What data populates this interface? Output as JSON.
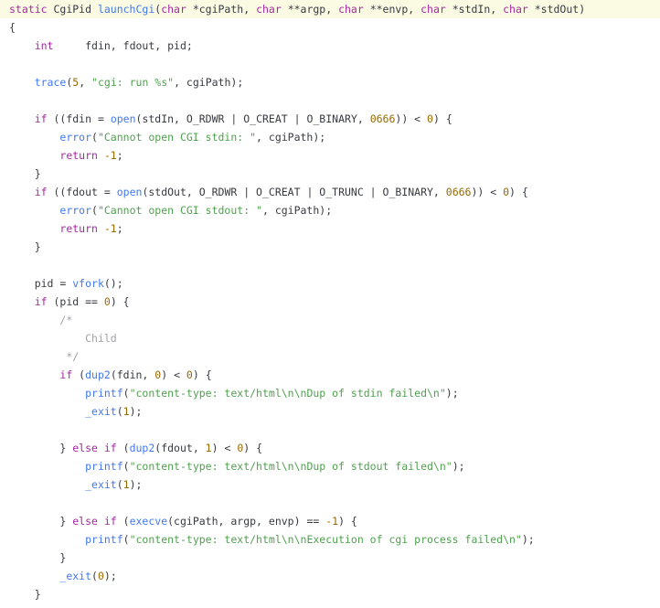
{
  "colors": {
    "kw": "#a626a4",
    "cm": "#a0a1a7",
    "fn": "#4078f2",
    "num": "#986801",
    "str": "#50a14f",
    "plain": "#383a42",
    "highlight": "#fbfbe3"
  },
  "code": {
    "lines": [
      {
        "tokens": [
          {
            "t": "kw",
            "v": "static "
          },
          {
            "t": "plain",
            "v": "CgiPid "
          },
          {
            "t": "fn",
            "v": "launchCgi"
          },
          {
            "t": "plain",
            "v": "("
          },
          {
            "t": "kw",
            "v": "char"
          },
          {
            "t": "plain",
            "v": " *cgiPath, "
          },
          {
            "t": "kw",
            "v": "char"
          },
          {
            "t": "plain",
            "v": " **argp, "
          },
          {
            "t": "kw",
            "v": "char"
          },
          {
            "t": "plain",
            "v": " **envp, "
          },
          {
            "t": "kw",
            "v": "char"
          },
          {
            "t": "plain",
            "v": " *stdIn, "
          },
          {
            "t": "kw",
            "v": "char"
          },
          {
            "t": "plain",
            "v": " *stdOut)"
          }
        ],
        "highlight": true
      },
      {
        "tokens": [
          {
            "t": "plain",
            "v": "{"
          }
        ]
      },
      {
        "tokens": [
          {
            "t": "plain",
            "v": "    "
          },
          {
            "t": "kw",
            "v": "int"
          },
          {
            "t": "plain",
            "v": "     fdin, fdout, pid;"
          }
        ]
      },
      {
        "tokens": [
          {
            "t": "plain",
            "v": ""
          }
        ]
      },
      {
        "tokens": [
          {
            "t": "plain",
            "v": "    "
          },
          {
            "t": "fn",
            "v": "trace"
          },
          {
            "t": "plain",
            "v": "("
          },
          {
            "t": "num",
            "v": "5"
          },
          {
            "t": "plain",
            "v": ", "
          },
          {
            "t": "str",
            "v": "\"cgi: run %s\""
          },
          {
            "t": "plain",
            "v": ", cgiPath);"
          }
        ]
      },
      {
        "tokens": [
          {
            "t": "plain",
            "v": ""
          }
        ]
      },
      {
        "tokens": [
          {
            "t": "plain",
            "v": "    "
          },
          {
            "t": "kw",
            "v": "if"
          },
          {
            "t": "plain",
            "v": " ((fdin = "
          },
          {
            "t": "fn",
            "v": "open"
          },
          {
            "t": "plain",
            "v": "(stdIn, O_RDWR | O_CREAT | O_BINARY, "
          },
          {
            "t": "num",
            "v": "0666"
          },
          {
            "t": "plain",
            "v": ")) < "
          },
          {
            "t": "num",
            "v": "0"
          },
          {
            "t": "plain",
            "v": ") {"
          }
        ]
      },
      {
        "tokens": [
          {
            "t": "plain",
            "v": "        "
          },
          {
            "t": "fn",
            "v": "error"
          },
          {
            "t": "plain",
            "v": "("
          },
          {
            "t": "str",
            "v": "\"Cannot open CGI stdin: \""
          },
          {
            "t": "plain",
            "v": ", cgiPath);"
          }
        ]
      },
      {
        "tokens": [
          {
            "t": "plain",
            "v": "        "
          },
          {
            "t": "kw",
            "v": "return"
          },
          {
            "t": "plain",
            "v": " "
          },
          {
            "t": "num",
            "v": "-1"
          },
          {
            "t": "plain",
            "v": ";"
          }
        ]
      },
      {
        "tokens": [
          {
            "t": "plain",
            "v": "    }"
          }
        ]
      },
      {
        "tokens": [
          {
            "t": "plain",
            "v": "    "
          },
          {
            "t": "kw",
            "v": "if"
          },
          {
            "t": "plain",
            "v": " ((fdout = "
          },
          {
            "t": "fn",
            "v": "open"
          },
          {
            "t": "plain",
            "v": "(stdOut, O_RDWR | O_CREAT | O_TRUNC | O_BINARY, "
          },
          {
            "t": "num",
            "v": "0666"
          },
          {
            "t": "plain",
            "v": ")) < "
          },
          {
            "t": "num",
            "v": "0"
          },
          {
            "t": "plain",
            "v": ") {"
          }
        ]
      },
      {
        "tokens": [
          {
            "t": "plain",
            "v": "        "
          },
          {
            "t": "fn",
            "v": "error"
          },
          {
            "t": "plain",
            "v": "("
          },
          {
            "t": "str",
            "v": "\"Cannot open CGI stdout: \""
          },
          {
            "t": "plain",
            "v": ", cgiPath);"
          }
        ]
      },
      {
        "tokens": [
          {
            "t": "plain",
            "v": "        "
          },
          {
            "t": "kw",
            "v": "return"
          },
          {
            "t": "plain",
            "v": " "
          },
          {
            "t": "num",
            "v": "-1"
          },
          {
            "t": "plain",
            "v": ";"
          }
        ]
      },
      {
        "tokens": [
          {
            "t": "plain",
            "v": "    }"
          }
        ]
      },
      {
        "tokens": [
          {
            "t": "plain",
            "v": ""
          }
        ]
      },
      {
        "tokens": [
          {
            "t": "plain",
            "v": "    pid = "
          },
          {
            "t": "fn",
            "v": "vfork"
          },
          {
            "t": "plain",
            "v": "();"
          }
        ]
      },
      {
        "tokens": [
          {
            "t": "plain",
            "v": "    "
          },
          {
            "t": "kw",
            "v": "if"
          },
          {
            "t": "plain",
            "v": " (pid == "
          },
          {
            "t": "num",
            "v": "0"
          },
          {
            "t": "plain",
            "v": ") {"
          }
        ]
      },
      {
        "tokens": [
          {
            "t": "plain",
            "v": "        "
          },
          {
            "t": "cm",
            "v": "/*"
          }
        ]
      },
      {
        "tokens": [
          {
            "t": "plain",
            "v": "            "
          },
          {
            "t": "cm",
            "v": "Child"
          }
        ]
      },
      {
        "tokens": [
          {
            "t": "plain",
            "v": "         "
          },
          {
            "t": "cm",
            "v": "*/"
          }
        ]
      },
      {
        "tokens": [
          {
            "t": "plain",
            "v": "        "
          },
          {
            "t": "kw",
            "v": "if"
          },
          {
            "t": "plain",
            "v": " ("
          },
          {
            "t": "fn",
            "v": "dup2"
          },
          {
            "t": "plain",
            "v": "(fdin, "
          },
          {
            "t": "num",
            "v": "0"
          },
          {
            "t": "plain",
            "v": ") < "
          },
          {
            "t": "num",
            "v": "0"
          },
          {
            "t": "plain",
            "v": ") {"
          }
        ]
      },
      {
        "tokens": [
          {
            "t": "plain",
            "v": "            "
          },
          {
            "t": "fn",
            "v": "printf"
          },
          {
            "t": "plain",
            "v": "("
          },
          {
            "t": "str",
            "v": "\"content-type: text/html\\n\\nDup of stdin failed\\n\""
          },
          {
            "t": "plain",
            "v": ");"
          }
        ]
      },
      {
        "tokens": [
          {
            "t": "plain",
            "v": "            "
          },
          {
            "t": "fn",
            "v": "_exit"
          },
          {
            "t": "plain",
            "v": "("
          },
          {
            "t": "num",
            "v": "1"
          },
          {
            "t": "plain",
            "v": ");"
          }
        ]
      },
      {
        "tokens": [
          {
            "t": "plain",
            "v": ""
          }
        ]
      },
      {
        "tokens": [
          {
            "t": "plain",
            "v": "        } "
          },
          {
            "t": "kw",
            "v": "else if"
          },
          {
            "t": "plain",
            "v": " ("
          },
          {
            "t": "fn",
            "v": "dup2"
          },
          {
            "t": "plain",
            "v": "(fdout, "
          },
          {
            "t": "num",
            "v": "1"
          },
          {
            "t": "plain",
            "v": ") < "
          },
          {
            "t": "num",
            "v": "0"
          },
          {
            "t": "plain",
            "v": ") {"
          }
        ]
      },
      {
        "tokens": [
          {
            "t": "plain",
            "v": "            "
          },
          {
            "t": "fn",
            "v": "printf"
          },
          {
            "t": "plain",
            "v": "("
          },
          {
            "t": "str",
            "v": "\"content-type: text/html\\n\\nDup of stdout failed\\n\""
          },
          {
            "t": "plain",
            "v": ");"
          }
        ]
      },
      {
        "tokens": [
          {
            "t": "plain",
            "v": "            "
          },
          {
            "t": "fn",
            "v": "_exit"
          },
          {
            "t": "plain",
            "v": "("
          },
          {
            "t": "num",
            "v": "1"
          },
          {
            "t": "plain",
            "v": ");"
          }
        ]
      },
      {
        "tokens": [
          {
            "t": "plain",
            "v": ""
          }
        ]
      },
      {
        "tokens": [
          {
            "t": "plain",
            "v": "        } "
          },
          {
            "t": "kw",
            "v": "else if"
          },
          {
            "t": "plain",
            "v": " ("
          },
          {
            "t": "fn",
            "v": "execve"
          },
          {
            "t": "plain",
            "v": "(cgiPath, argp, envp) == "
          },
          {
            "t": "num",
            "v": "-1"
          },
          {
            "t": "plain",
            "v": ") {"
          }
        ]
      },
      {
        "tokens": [
          {
            "t": "plain",
            "v": "            "
          },
          {
            "t": "fn",
            "v": "printf"
          },
          {
            "t": "plain",
            "v": "("
          },
          {
            "t": "str",
            "v": "\"content-type: text/html\\n\\nExecution of cgi process failed\\n\""
          },
          {
            "t": "plain",
            "v": ");"
          }
        ]
      },
      {
        "tokens": [
          {
            "t": "plain",
            "v": "        }"
          }
        ]
      },
      {
        "tokens": [
          {
            "t": "plain",
            "v": "        "
          },
          {
            "t": "fn",
            "v": "_exit"
          },
          {
            "t": "plain",
            "v": "("
          },
          {
            "t": "num",
            "v": "0"
          },
          {
            "t": "plain",
            "v": ");"
          }
        ]
      },
      {
        "tokens": [
          {
            "t": "plain",
            "v": "    }"
          }
        ]
      }
    ]
  }
}
